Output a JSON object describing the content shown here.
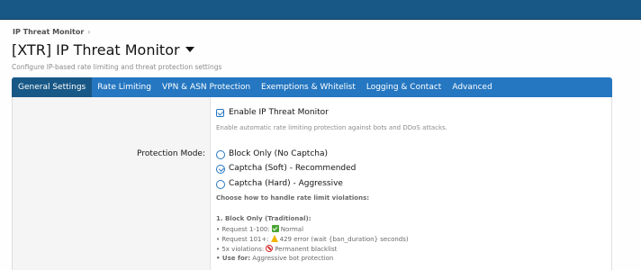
{
  "breadcrumb": {
    "item": "IP Threat Monitor",
    "separator": "›"
  },
  "page": {
    "title": "[XTR] IP Threat Monitor",
    "description": "Configure IP-based rate limiting and threat protection settings"
  },
  "tabs": [
    {
      "label": "General Settings",
      "active": true
    },
    {
      "label": "Rate Limiting"
    },
    {
      "label": "VPN & ASN Protection"
    },
    {
      "label": "Exemptions & Whitelist"
    },
    {
      "label": "Logging & Contact"
    },
    {
      "label": "Advanced"
    }
  ],
  "settings": {
    "enable": {
      "label": "Enable IP Threat Monitor",
      "checked": true,
      "hint": "Enable automatic rate limiting protection against bots and DDoS attacks."
    },
    "protection_mode": {
      "label": "Protection Mode:",
      "options": [
        {
          "label": "Block Only (No Captcha)",
          "checked": false
        },
        {
          "label": "Captcha (Soft) - Recommended",
          "checked": true
        },
        {
          "label": "Captcha (Hard) - Aggressive",
          "checked": false
        }
      ],
      "hint": "Choose how to handle rate limit violations:",
      "explain_title": "1. Block Only (Traditional):",
      "lines": {
        "l1_prefix": "• Request 1-100:",
        "l1_text": "Normal",
        "l2_prefix": "• Request 101+:",
        "l2_text": "429 error (wait {ban_duration} seconds)",
        "l3_prefix": "• 5x violations:",
        "l3_text": "Permanent blacklist",
        "l4_prefix": "• Use for:",
        "l4_text": "Aggressive bot protection"
      }
    }
  },
  "colors": {
    "topbar": "#185886",
    "tabbar": "#2577c1",
    "accent": "#2577c1"
  }
}
